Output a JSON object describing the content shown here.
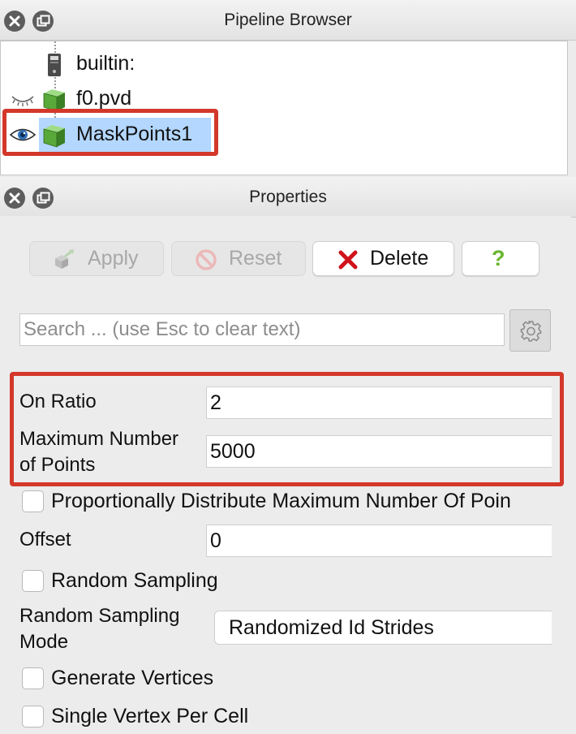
{
  "pipeline_browser": {
    "title": "Pipeline Browser",
    "items": [
      {
        "label": "builtin:",
        "icon": "server-icon",
        "visibility": "none"
      },
      {
        "label": "f0.pvd",
        "icon": "data-cube-icon",
        "visibility": "hidden"
      },
      {
        "label": "MaskPoints1",
        "icon": "data-cube-icon",
        "visibility": "visible",
        "selected": true
      }
    ]
  },
  "properties": {
    "title": "Properties",
    "buttons": {
      "apply": "Apply",
      "reset": "Reset",
      "delete": "Delete",
      "help": "?"
    },
    "search": {
      "placeholder": "Search ... (use Esc to clear text)"
    },
    "fields": {
      "on_ratio": {
        "label": "On Ratio",
        "value": "2"
      },
      "max_points": {
        "label": "Maximum Number of Points",
        "label_line1": "Maximum Number",
        "label_line2": "of Points",
        "value": "5000"
      },
      "proportional": {
        "label": "Proportionally Distribute Maximum Number Of Poin",
        "checked": false
      },
      "offset": {
        "label": "Offset",
        "value": "0"
      },
      "random_sampling": {
        "label": "Random Sampling",
        "checked": false
      },
      "random_mode": {
        "label": "Random Sampling Mode",
        "label_line1": "Random Sampling",
        "label_line2": "Mode",
        "value": "Randomized Id Strides"
      },
      "generate_vertices": {
        "label": "Generate Vertices",
        "checked": false
      },
      "single_vertex": {
        "label": "Single Vertex Per Cell",
        "checked": false
      }
    }
  },
  "colors": {
    "highlight": "#d3382a",
    "selection": "#b3d7fe",
    "delete_red": "#d0121b",
    "help_green": "#69b52e"
  }
}
